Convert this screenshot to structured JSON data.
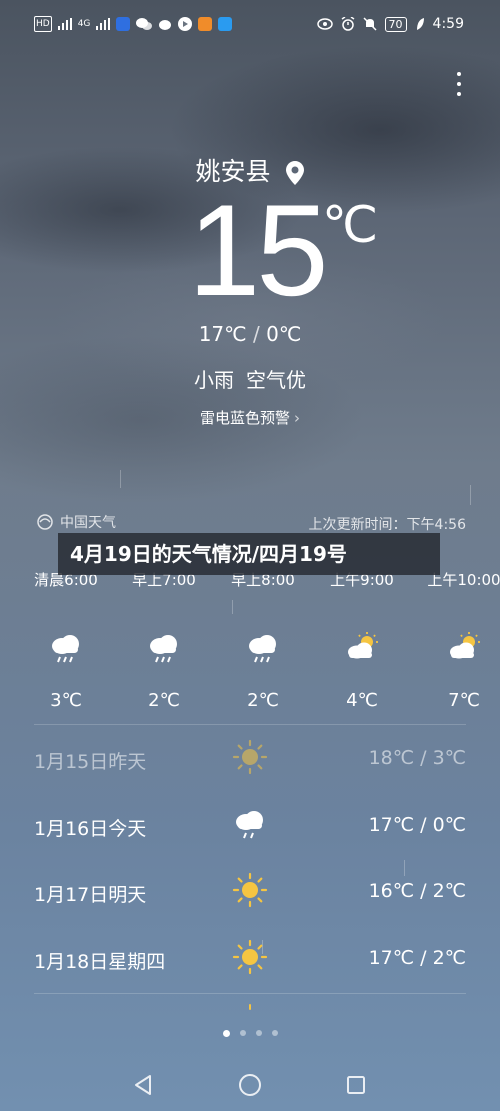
{
  "status_bar": {
    "left_icons": [
      "hd-icon",
      "signal-icon",
      "4g-signal-icon",
      "baidu-app-icon",
      "wechat-icon",
      "weibo-icon",
      "video-app-icon",
      "search-app-icon"
    ],
    "network_badge": "4G",
    "battery": "70",
    "time": "4:59"
  },
  "location": {
    "name": "姚安县"
  },
  "current": {
    "temperature": "15",
    "unit": "℃",
    "high": "17℃",
    "low": "0℃",
    "separator": "/",
    "condition": "小雨",
    "air_quality": "空气优",
    "alert": "雷电蓝色预警",
    "alert_chevron": "›"
  },
  "source": {
    "name": "中国天气",
    "updated": "上次更新时间：下午4:56"
  },
  "banner": {
    "text": "4月19日的天气情况/四月19号"
  },
  "hourly": [
    {
      "time": "清晨6:00",
      "icon": "rain-cloud-icon",
      "temp": "3℃"
    },
    {
      "time": "早上7:00",
      "icon": "rain-cloud-icon",
      "temp": "2℃"
    },
    {
      "time": "早上8:00",
      "icon": "rain-cloud-icon",
      "temp": "2℃"
    },
    {
      "time": "上午9:00",
      "icon": "partly-sunny-icon",
      "temp": "4℃"
    },
    {
      "time": "上午10:00",
      "icon": "partly-sunny-icon",
      "temp": "7℃"
    }
  ],
  "daily": [
    {
      "label": "1月15日昨天",
      "icon": "sun-icon",
      "range": "18℃ / 3℃"
    },
    {
      "label": "1月16日今天",
      "icon": "rain-cloud-icon",
      "range": "17℃ / 0℃"
    },
    {
      "label": "1月17日明天",
      "icon": "sun-icon",
      "range": "16℃ / 2℃"
    },
    {
      "label": "1月18日星期四",
      "icon": "sun-icon",
      "range": "17℃ / 2℃"
    }
  ],
  "page_indicator": {
    "count": 4,
    "active": 0
  },
  "colors": {
    "sun": "#f5c542",
    "text": "#ffffff",
    "banner_bg": "#2c3038"
  }
}
